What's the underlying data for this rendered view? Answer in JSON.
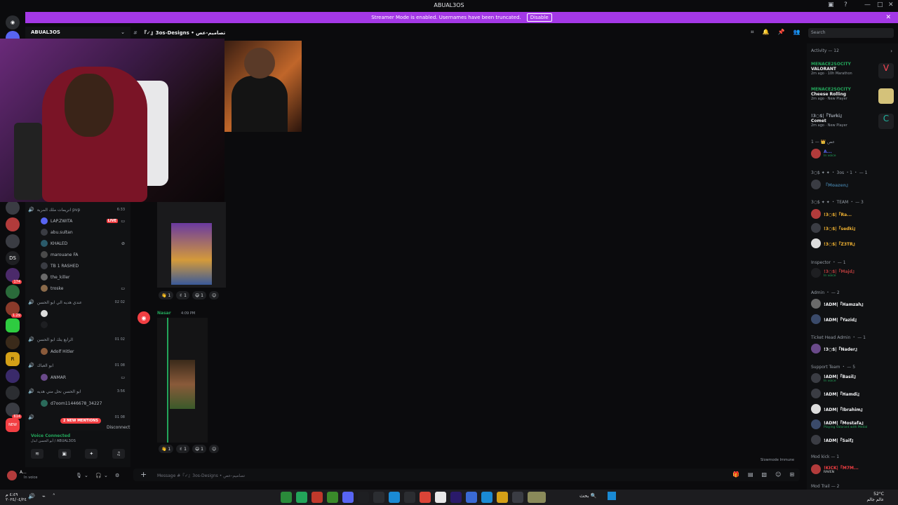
{
  "window": {
    "title": "ABUAL3OS"
  },
  "banner": {
    "text": "Streamer Mode is enabled. Usernames have been truncated.",
    "disable_label": "Disable",
    "color": "#a438e6"
  },
  "rail": {
    "servers": [
      {
        "label": "",
        "badge": ""
      },
      {
        "label": "",
        "badge": "168"
      },
      {
        "label": "DS",
        "badge": ""
      },
      {
        "label": "",
        "badge": "174"
      },
      {
        "label": "",
        "badge": "1.29"
      },
      {
        "label": "R",
        "badge": ""
      },
      {
        "label": "",
        "badge": "614"
      },
      {
        "label": "NEW",
        "badge": ""
      }
    ]
  },
  "sidebar": {
    "server_name": "ABUAL3OS",
    "voice_channels": [
      {
        "name": "انريمات ملك المربة pvp",
        "count": "6:33",
        "users": [
          {
            "name": "LAP.ZWITA",
            "live": "LIVE"
          },
          {
            "name": "abu.sultan"
          },
          {
            "name": "KHALED"
          },
          {
            "name": "marouane FA"
          },
          {
            "name": "TB 1 RASHED"
          },
          {
            "name": "the_killer"
          },
          {
            "name": "troske"
          }
        ]
      },
      {
        "name": "عندي هديه الي ابو الحسن",
        "count": "02  02",
        "users": [
          {
            "name": ""
          },
          {
            "name": ""
          }
        ]
      },
      {
        "name": "الرابع يتك ابو الحسن",
        "count": "01  02",
        "users": [
          {
            "name": "Adolf Hitler"
          }
        ]
      },
      {
        "name": "ابو العباك",
        "count": "01  08",
        "users": [
          {
            "name": "ANMAR"
          }
        ]
      },
      {
        "name": "ابو الحسن نحل مني هديه",
        "count": "3:56",
        "users": [
          {
            "name": "d7oom11446678_34227"
          }
        ]
      },
      {
        "name": "",
        "count": "01  08",
        "users": []
      }
    ],
    "mentions": "2 NEW MENTIONS",
    "voice_status": {
      "connected": "Voice Connected",
      "sub": "أبو الحسن ابدل / ABUAL3OS",
      "disconnect": "Disconnect"
    }
  },
  "user_panel": {
    "name": "A...",
    "status": "In voice"
  },
  "channel": {
    "name": "『✓』3os-Designs • تصاميم-عص",
    "composer_placeholder": "Message #『✓』3os-Designs • تصاميم-عص"
  },
  "search": {
    "placeholder": "Search"
  },
  "messages": {
    "author": "Nasar",
    "time": "4:09 PM",
    "reactions_1": [
      "👋 1",
      "✌ 1",
      "😄 1"
    ],
    "reactions_2": [
      "👋 1",
      "✌ 1",
      "😄 1"
    ],
    "slowmode": "Slowmode Immune"
  },
  "members": {
    "activity_header": "Activity — 12",
    "activities": [
      {
        "user": "MENACE2SOCITY",
        "game": "VALORANT",
        "meta": "2m ago · 10h Marathon",
        "color": "#ff4655"
      },
      {
        "user": "MENACE2SOCITY",
        "game": "Cheese Rolling",
        "meta": "2m ago · New Player",
        "color": "#d4c27a"
      },
      {
        "user": "!3○$|『Turki』",
        "game": "Comet",
        "meta": "2m ago · New Player",
        "color": "#1fb5a0"
      }
    ],
    "groups": [
      {
        "header": "1 — 👑 عص",
        "members": [
          {
            "name": "A...",
            "status": "In voice"
          }
        ]
      },
      {
        "header": "3○$ ✦ ✦ ・ 3os ・1 ・ — 1",
        "members": [
          {
            "name": "『Moazen』",
            "status": ""
          }
        ]
      },
      {
        "header": "3○$ ✦ ✦ ・ TEAM ・ — 3",
        "members": [
          {
            "name": "!3○$|『Ra...",
            "status": ""
          },
          {
            "name": "!3○$|『sedki』",
            "status": ""
          },
          {
            "name": "!3○$|『Z3TR』",
            "status": ""
          }
        ]
      },
      {
        "header": "Inspector ・ — 1",
        "members": [
          {
            "name": "!3○$|『Majd』",
            "status": "In voice"
          }
        ]
      },
      {
        "header": "Admin ・ — 2",
        "members": [
          {
            "name": "!ADM|『Hamzah』",
            "status": ""
          },
          {
            "name": "!ADM|『Yazid』",
            "status": ""
          }
        ]
      },
      {
        "header": "Ticket Head Admin ・ — 1",
        "members": [
          {
            "name": "!3○$|『Nader』",
            "status": ""
          }
        ]
      },
      {
        "header": "Support Team ・ — 5",
        "members": [
          {
            "name": "!ADM|『Basil』",
            "status": "In voice"
          },
          {
            "name": "!ADM|『Hamdi』",
            "status": ""
          },
          {
            "name": "!ADM|『Ibrahim』",
            "status": ""
          },
          {
            "name": "!ADM|『Mostafa』",
            "status": "Playing Valorant with Medal"
          },
          {
            "name": "!ADM|『Saif』",
            "status": ""
          }
        ]
      },
      {
        "header": "Mod kick — 1",
        "members": [
          {
            "name": "!KICK|『M7M...",
            "status": "RAVEN"
          }
        ]
      },
      {
        "header": "Mod Trail — 2",
        "members": []
      }
    ]
  },
  "taskbar": {
    "time": "52°C",
    "date": "عالم جالم",
    "left_time": "٤:٤٩ م",
    "left_date": "٢٠٢٤/٠٤/٢٤",
    "search_label": "بحث"
  }
}
